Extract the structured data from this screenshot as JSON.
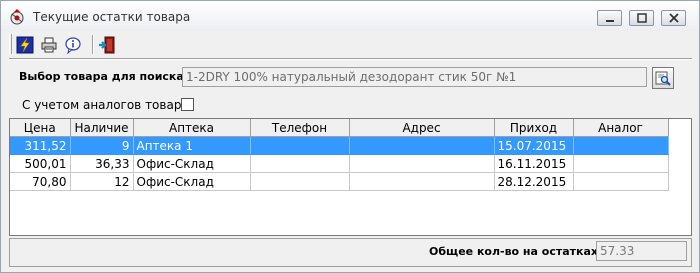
{
  "window": {
    "title": "Текущие остатки товара",
    "icons": [
      "app-icon",
      "minimize-icon",
      "maximize-icon",
      "close-icon"
    ]
  },
  "toolbar": {
    "buttons": [
      {
        "icon": "lightning-refresh-icon",
        "label": ""
      },
      {
        "icon": "printer-icon",
        "label": ""
      },
      {
        "icon": "info-icon",
        "label": ""
      },
      {
        "icon": "exit-door-icon",
        "label": ""
      }
    ]
  },
  "search": {
    "label": "Выбор товара для поиска",
    "value": "1-2DRY 100% натуральный дезодорант стик 50г №1",
    "button_icon": "search-lookup-icon"
  },
  "analogs": {
    "label": "С учетом аналогов товара",
    "checked": false
  },
  "table": {
    "columns": [
      "Цена",
      "Наличие",
      "Аптека",
      "Телефон",
      "Адрес",
      "Приход",
      "Аналог"
    ],
    "rows": [
      {
        "price": "311,52",
        "stock": "9",
        "pharmacy": "Аптека 1",
        "phone": "",
        "address": "",
        "arrival": "15.07.2015",
        "analog": "",
        "selected": true
      },
      {
        "price": "500,01",
        "stock": "36,33",
        "pharmacy": "Офис-Склад",
        "phone": "",
        "address": "",
        "arrival": "16.11.2015",
        "analog": "",
        "selected": false
      },
      {
        "price": "70,80",
        "stock": "12",
        "pharmacy": "Офис-Склад",
        "phone": "",
        "address": "",
        "arrival": "28.12.2015",
        "analog": "",
        "selected": false
      }
    ]
  },
  "total": {
    "label": "Общее кол-во на остатках",
    "value": "57.33"
  },
  "colors": {
    "selection": "#3399ff",
    "window_bg": "#f0f0f0",
    "grid_bg": "#ffffff"
  }
}
